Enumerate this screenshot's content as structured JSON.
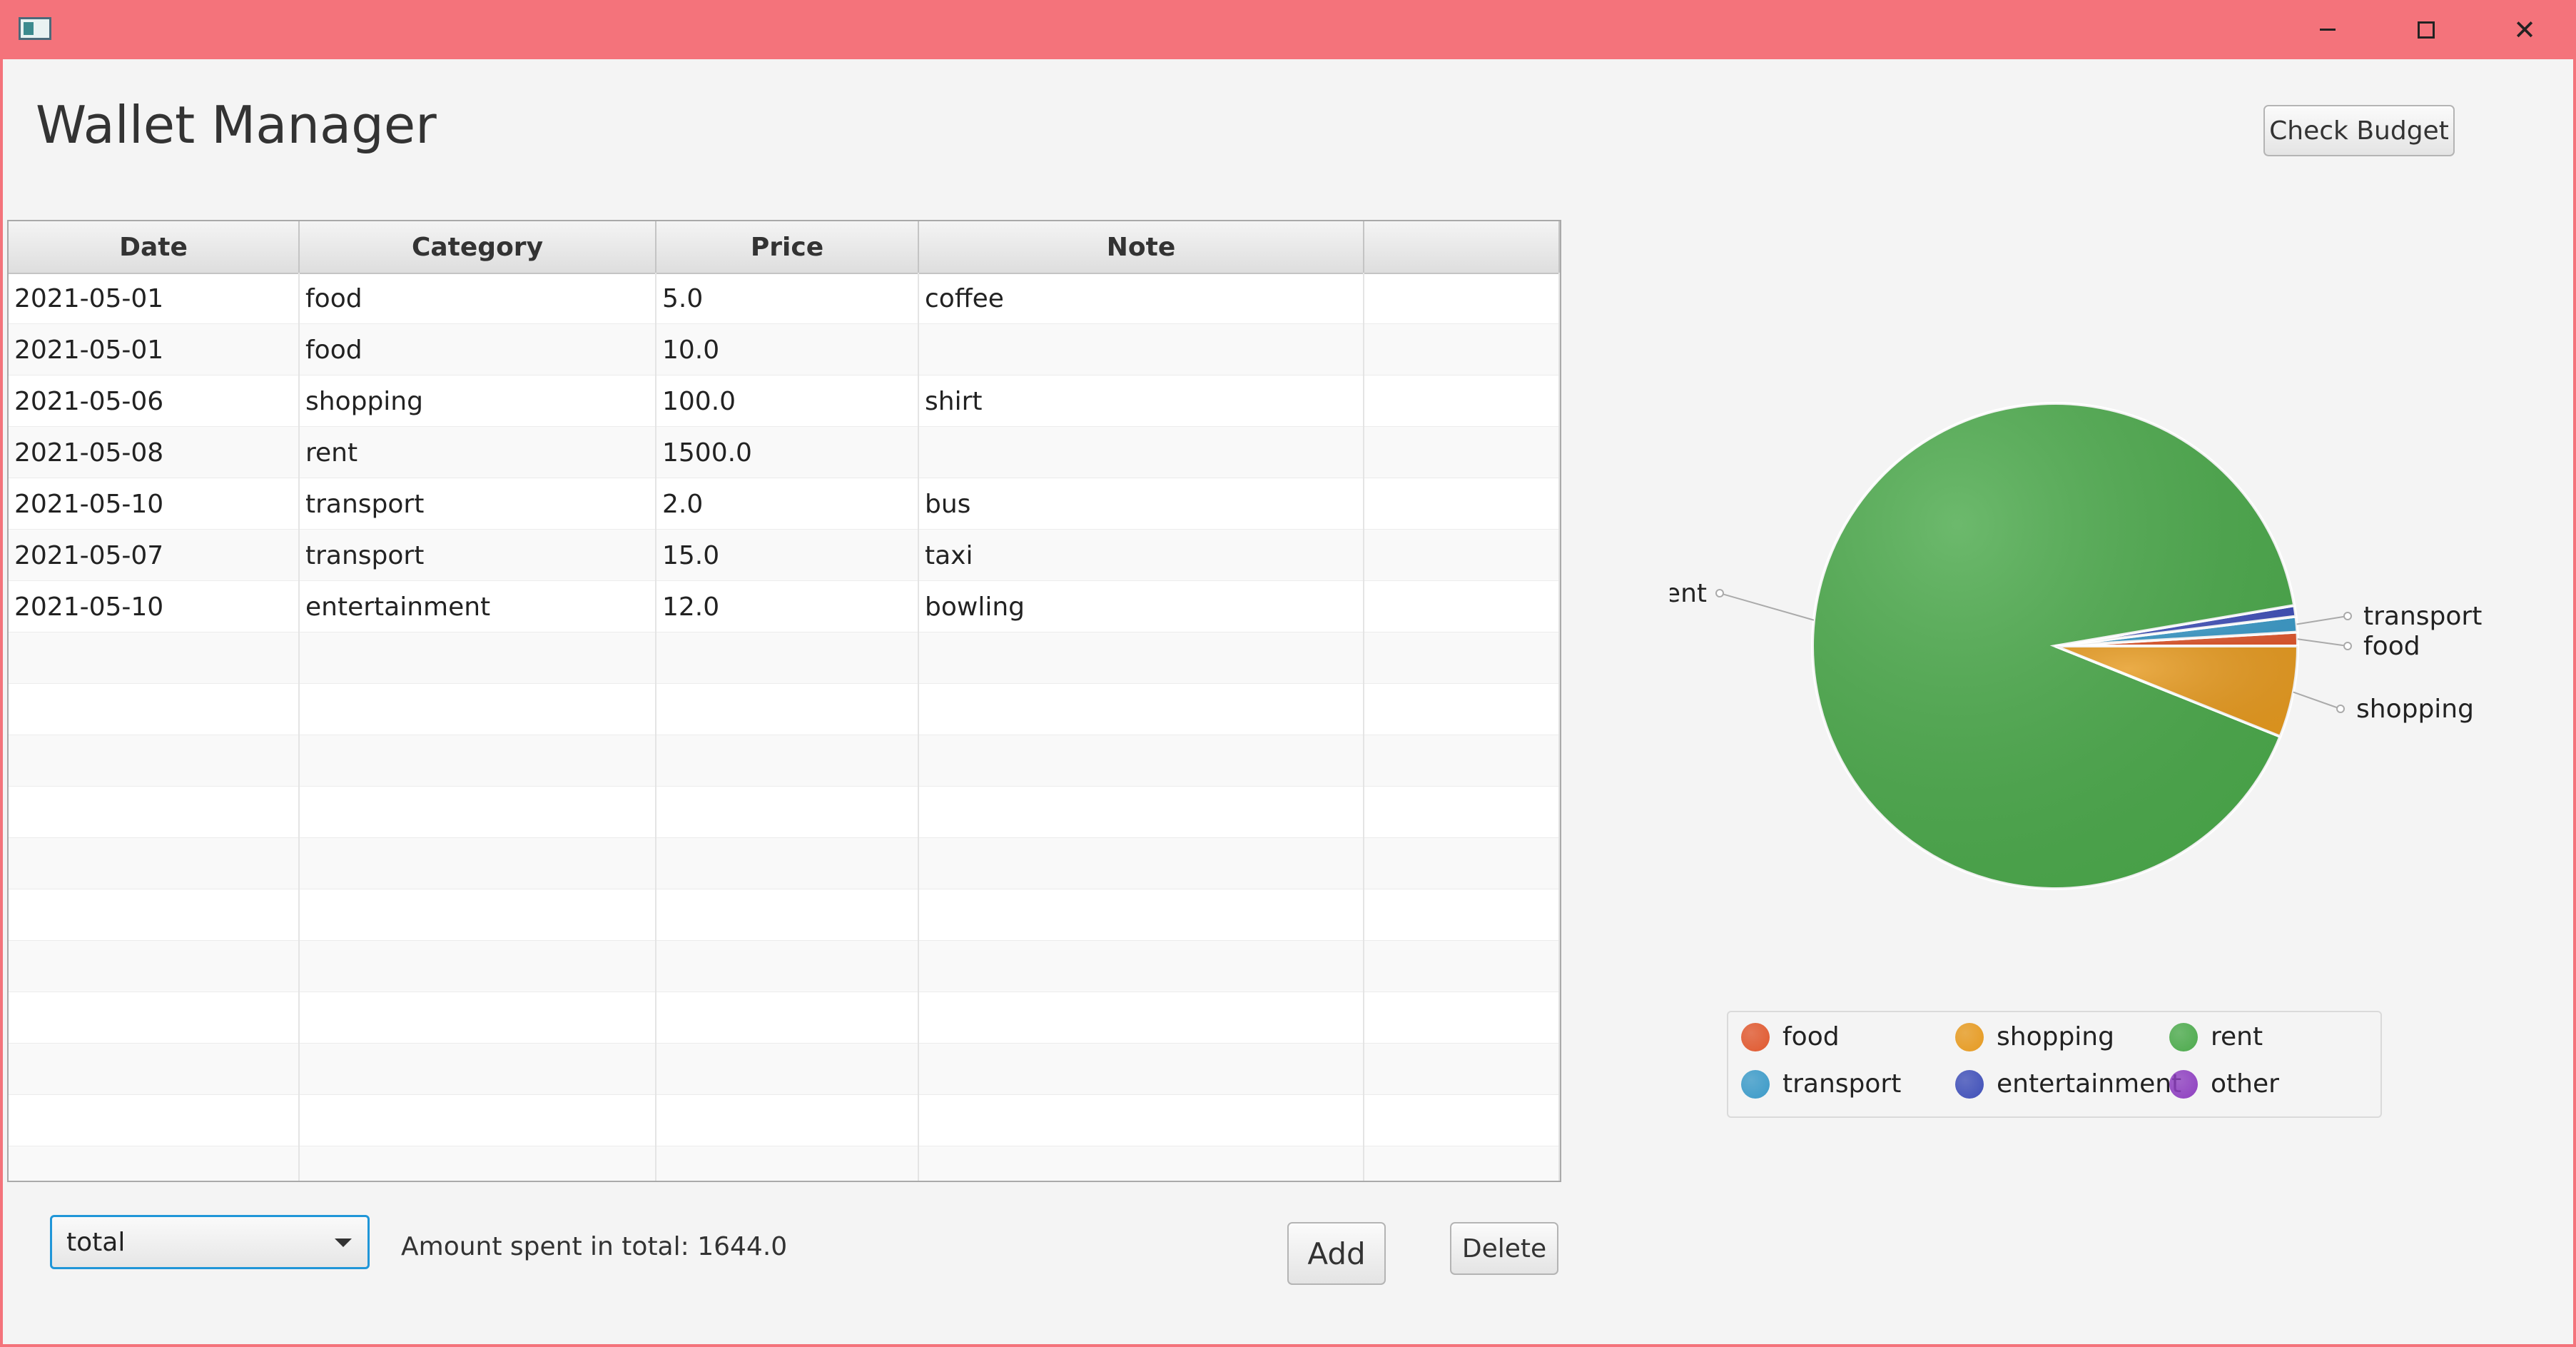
{
  "window": {
    "title": "",
    "controls": {
      "minimize": "minimize-icon",
      "maximize": "maximize-icon",
      "close": "✕"
    },
    "app_icon": "app-window-icon"
  },
  "app": {
    "title": "Wallet Manager",
    "check_budget_label": "Check Budget"
  },
  "table": {
    "columns": [
      "Date",
      "Category",
      "Price",
      "Note",
      ""
    ],
    "rows": [
      [
        "2021-05-01",
        "food",
        "5.0",
        "coffee",
        ""
      ],
      [
        "2021-05-01",
        "food",
        "10.0",
        "",
        ""
      ],
      [
        "2021-05-06",
        "shopping",
        "100.0",
        "shirt",
        ""
      ],
      [
        "2021-05-08",
        "rent",
        "1500.0",
        "",
        ""
      ],
      [
        "2021-05-10",
        "transport",
        "2.0",
        "bus",
        ""
      ],
      [
        "2021-05-07",
        "transport",
        "15.0",
        "taxi",
        ""
      ],
      [
        "2021-05-10",
        "entertainment",
        "12.0",
        "bowling",
        ""
      ]
    ],
    "empty_rows": 11
  },
  "footer": {
    "filter_selected": "total",
    "amount_text": "Amount spent in total: 1644.0",
    "add_label": "Add",
    "delete_label": "Delete"
  },
  "chart_data": {
    "type": "pie",
    "title": "",
    "slices": [
      {
        "label": "rent",
        "value": 1500.0,
        "color": "#4caa4c"
      },
      {
        "label": "shopping",
        "value": 100.0,
        "color": "#e69a20"
      },
      {
        "label": "food",
        "value": 15.0,
        "color": "#e0582e"
      },
      {
        "label": "transport",
        "value": 17.0,
        "color": "#3b9ac8"
      },
      {
        "label": "entertainment",
        "value": 12.0,
        "color": "#3f4fb8"
      }
    ],
    "legend": [
      {
        "label": "food",
        "color": "#e0582e"
      },
      {
        "label": "shopping",
        "color": "#e69a20"
      },
      {
        "label": "rent",
        "color": "#4caa4c"
      },
      {
        "label": "transport",
        "color": "#3b9ac8"
      },
      {
        "label": "entertainment",
        "color": "#3f4fb8"
      },
      {
        "label": "other",
        "color": "#8e3fc0"
      }
    ],
    "legend_position": "bottom"
  }
}
